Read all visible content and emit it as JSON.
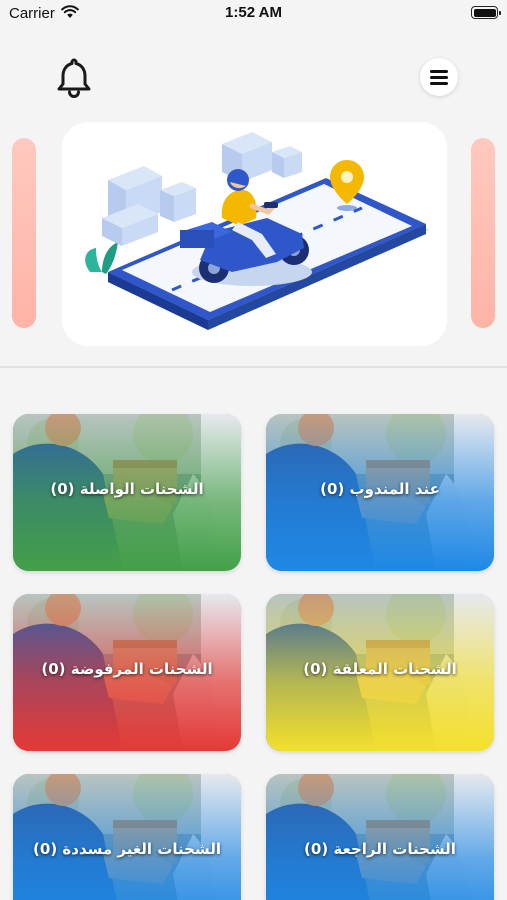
{
  "status_bar": {
    "carrier": "Carrier",
    "time": "1:52 AM"
  },
  "header": {
    "notification_icon": "bell-icon",
    "menu_icon": "hamburger-menu-icon"
  },
  "banner": {
    "illustration": "delivery-scooter-on-phone-illustration",
    "side_card_color": "#ffc2b8"
  },
  "tiles": [
    {
      "label": "عند المندوب (0)",
      "color": "#1e88e5"
    },
    {
      "label": "الشحنات الواصلة (0)",
      "color": "#43a047"
    },
    {
      "label": "الشحنات المعلقة (0)",
      "color": "#f4e02a"
    },
    {
      "label": "الشحنات المرفوضة (0)",
      "color": "#e53935"
    },
    {
      "label": "الشحنات الراجعة (0)",
      "color": "#1e88e5"
    },
    {
      "label": "الشحنات الغير مسددة (0)",
      "color": "#1e88e5"
    }
  ]
}
